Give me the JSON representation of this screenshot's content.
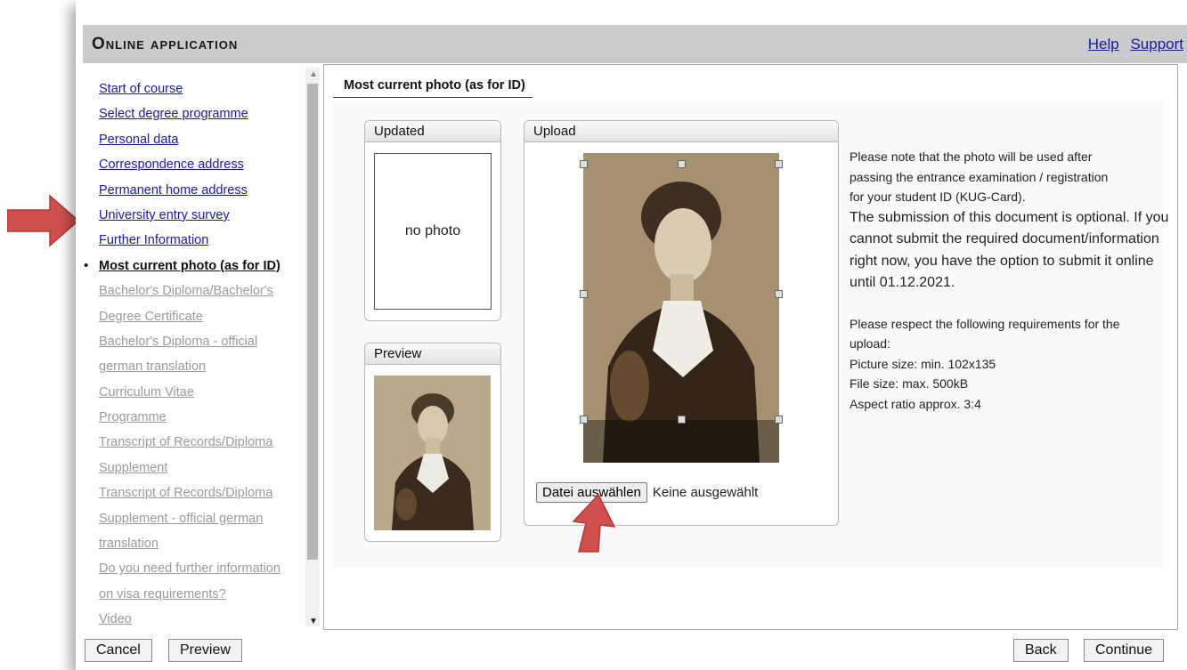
{
  "header": {
    "title": "Online application",
    "links": [
      "Help",
      "Support"
    ]
  },
  "sidebar": {
    "items": [
      {
        "label": "Start of course",
        "state": "done"
      },
      {
        "label": "Select degree programme",
        "state": "done"
      },
      {
        "label": "Personal data",
        "state": "done"
      },
      {
        "label": "Correspondence address",
        "state": "done"
      },
      {
        "label": "Permanent home address",
        "state": "done"
      },
      {
        "label": "University entry survey",
        "state": "done"
      },
      {
        "label": "Further Information",
        "state": "done"
      },
      {
        "label": "Most current photo (as for ID)",
        "state": "current"
      },
      {
        "label": "Bachelor's Diploma/Bachelor's",
        "state": "todo"
      },
      {
        "label": "Degree Certificate",
        "state": "todo"
      },
      {
        "label": "Bachelor's Diploma - official",
        "state": "todo"
      },
      {
        "label": "german translation",
        "state": "todo"
      },
      {
        "label": "Curriculum Vitae",
        "state": "todo"
      },
      {
        "label": "Programme",
        "state": "todo"
      },
      {
        "label": "Transcript of Records/Diploma",
        "state": "todo"
      },
      {
        "label": "Supplement",
        "state": "todo"
      },
      {
        "label": "Transcript of Records/Diploma",
        "state": "todo"
      },
      {
        "label": "Supplement - official german",
        "state": "todo"
      },
      {
        "label": "translation",
        "state": "todo"
      },
      {
        "label": "Do you need further information",
        "state": "todo"
      },
      {
        "label": "on visa requirements?",
        "state": "todo"
      },
      {
        "label": "Video",
        "state": "todo"
      }
    ]
  },
  "main": {
    "section_title": "Most current photo (as for ID)",
    "updated": {
      "heading": "Updated",
      "placeholder": "no photo"
    },
    "preview": {
      "heading": "Preview"
    },
    "upload": {
      "heading": "Upload",
      "file_button": "Datei auswählen",
      "file_status": "Keine ausgewählt"
    },
    "info": {
      "note_lines": [
        "Please note that the photo will be used after",
        "passing the entrance examination / registration",
        "for your student ID (KUG-Card)."
      ],
      "optional_text": "The submission of this document is optional. If you cannot submit the required document/information right now, you have the option to submit it online until 01.12.2021.",
      "requirements_lines": [
        "Please respect the following requirements for the",
        "upload:",
        "Picture size: min. 102x135",
        "File size: max. 500kB",
        "Aspect ratio approx. 3:4"
      ]
    }
  },
  "footer": {
    "cancel": "Cancel",
    "preview": "Preview",
    "back": "Back",
    "continue": "Continue"
  },
  "colors": {
    "header_bg": "#c9cbcc",
    "link": "#1a1a9a",
    "disabled_link": "#9a9a9a",
    "annotation_arrow": "#d05050"
  }
}
